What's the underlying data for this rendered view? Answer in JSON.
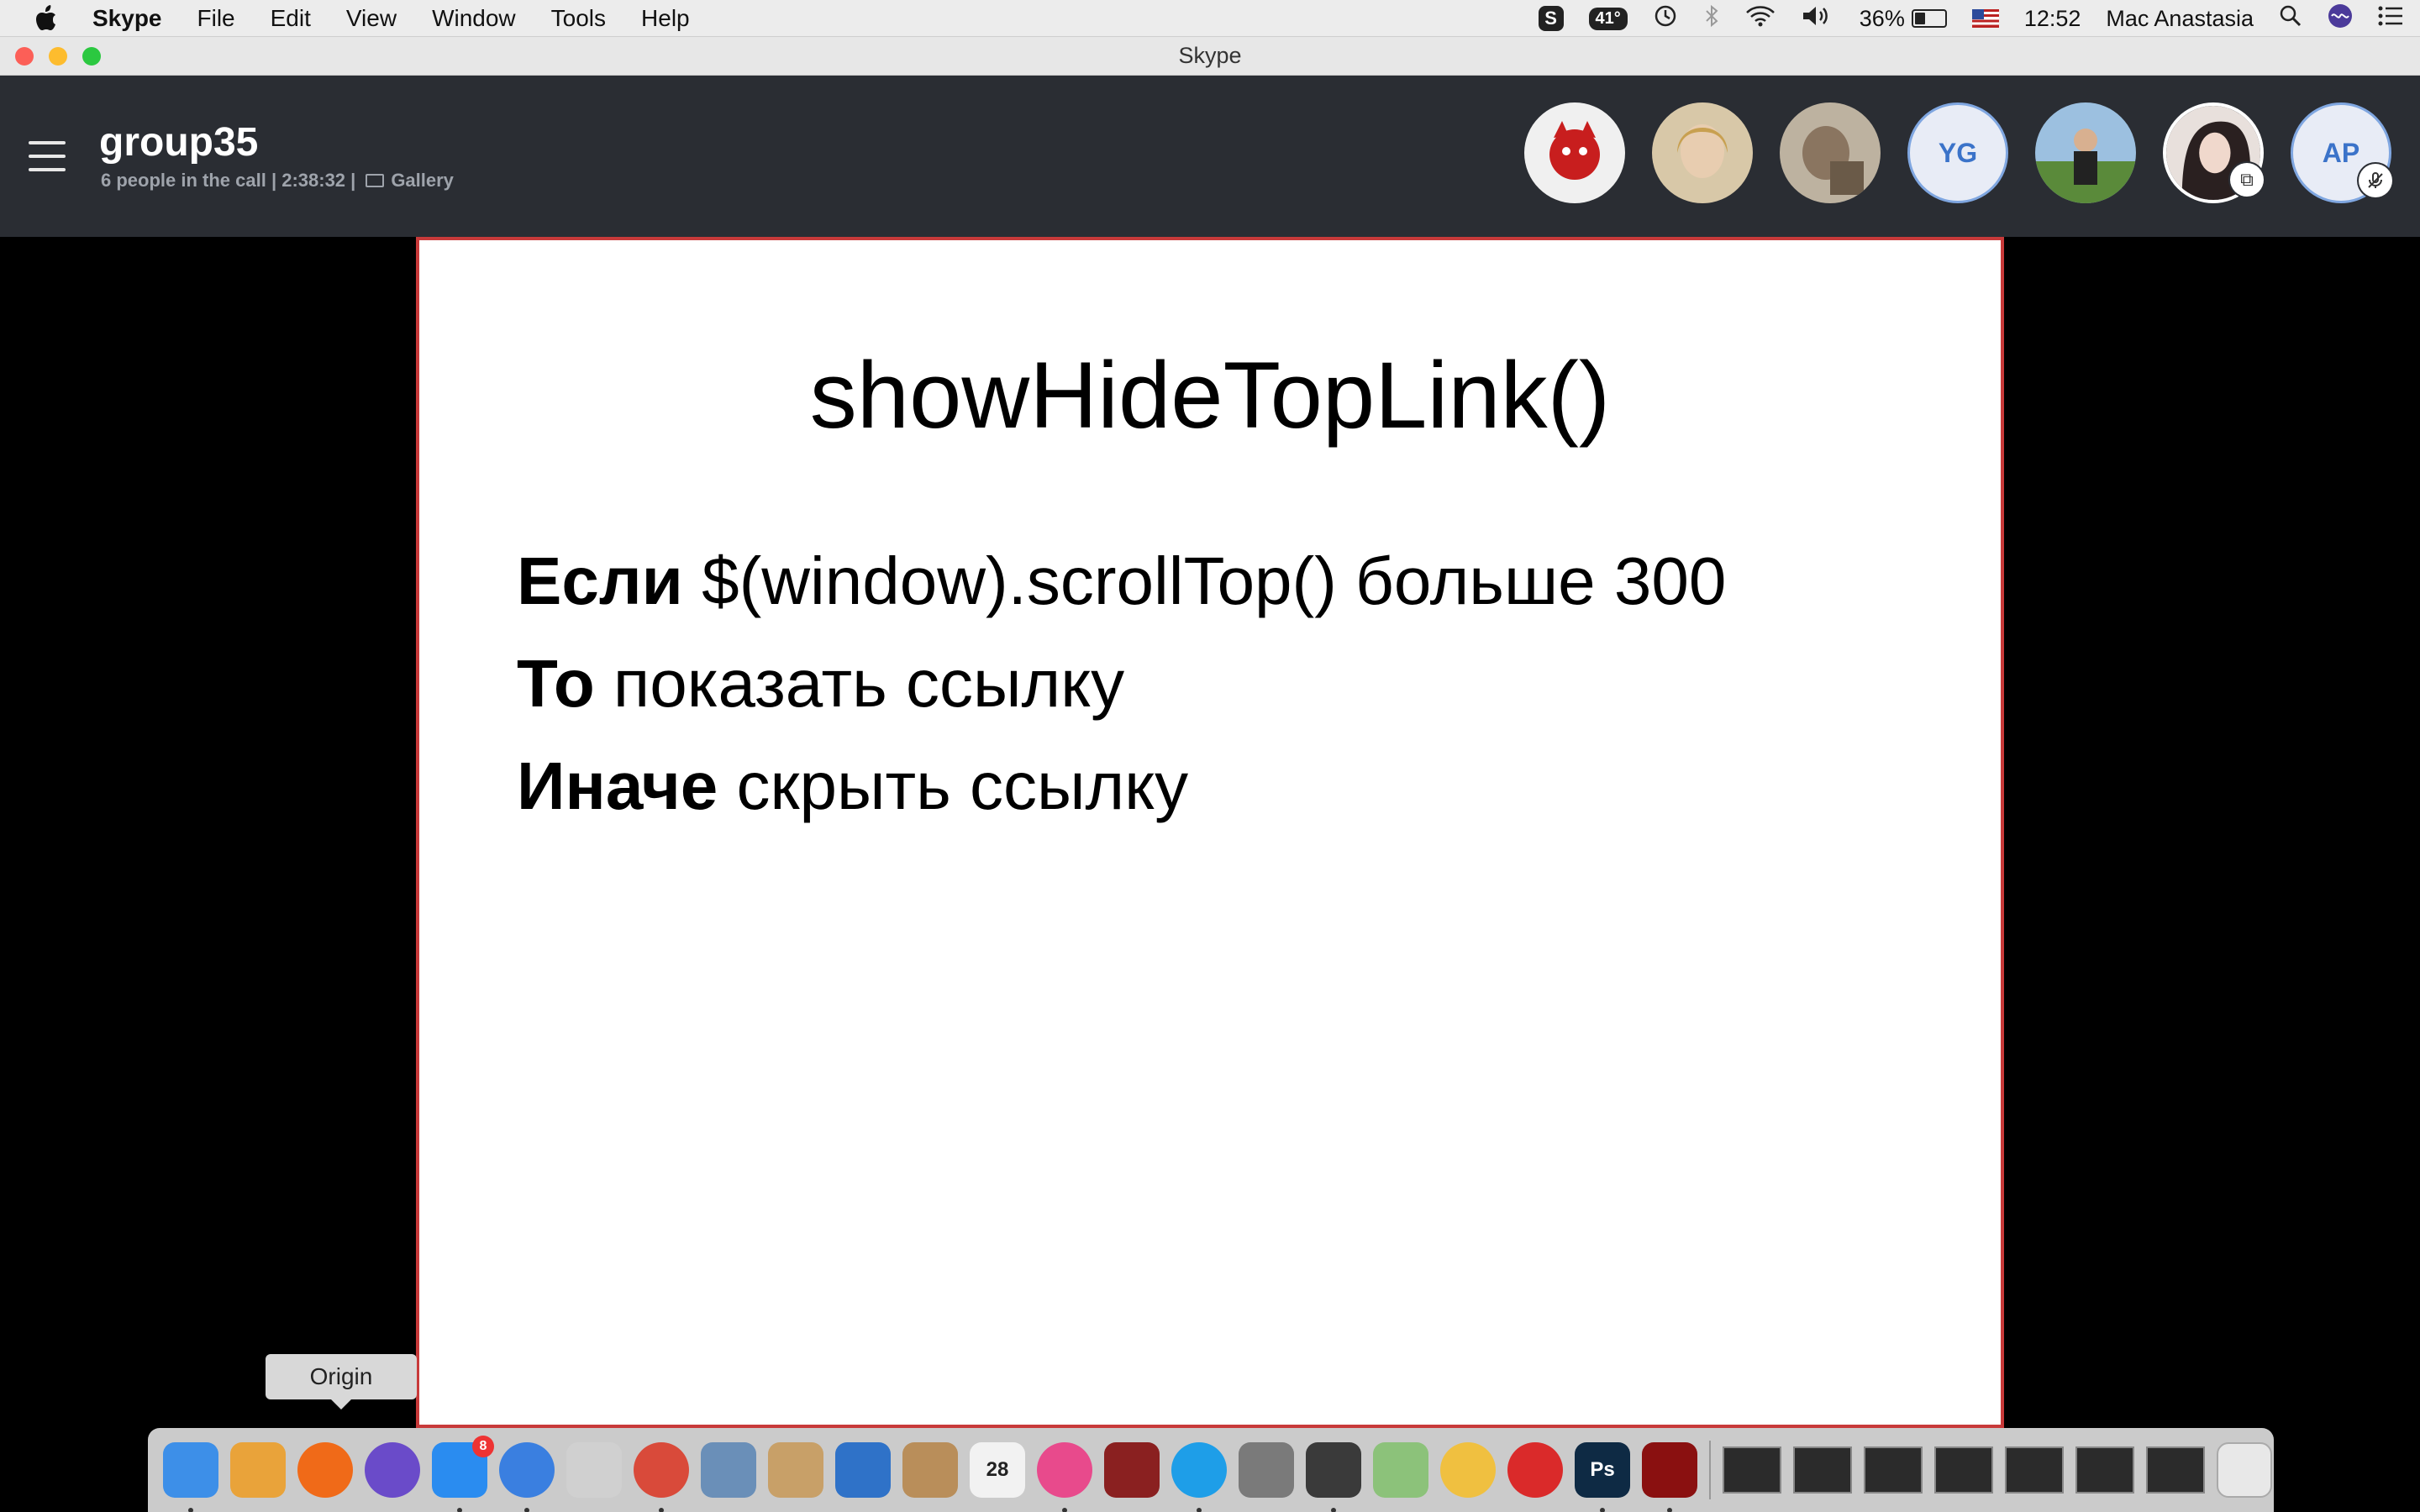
{
  "menubar": {
    "app_name": "Skype",
    "items": [
      "File",
      "Edit",
      "View",
      "Window",
      "Tools",
      "Help"
    ],
    "status": {
      "temperature": "41°",
      "battery": "36%",
      "battery_level": 0.36,
      "clock": "12:52",
      "user": "Mac Anastasia"
    }
  },
  "window": {
    "title": "Skype"
  },
  "call": {
    "group_name": "group35",
    "subtitle": "6 people in the call | 2:38:32  |",
    "view_mode": "Gallery",
    "participants": [
      {
        "type": "photo",
        "icon": "red-devil-avatar",
        "color": "#c81e1e"
      },
      {
        "type": "photo",
        "icon": "woman-blonde-avatar",
        "color": "#b8a27a"
      },
      {
        "type": "photo",
        "icon": "person-thinking-avatar",
        "color": "#8c7a66"
      },
      {
        "type": "initials",
        "initials": "YG"
      },
      {
        "type": "photo",
        "icon": "man-outdoors-avatar",
        "color": "#4e7a3a"
      },
      {
        "type": "photo",
        "icon": "woman-dark-hair-avatar",
        "color": "#3a3030",
        "badge": "screen-share-icon",
        "selected": true
      },
      {
        "type": "initials",
        "initials": "AP",
        "badge": "mic-muted-icon"
      }
    ]
  },
  "slide": {
    "title": "showHideTopLink()",
    "lines": [
      {
        "bold": "Если",
        "rest": " $(window).scrollTop() больше 300"
      },
      {
        "bold": "То",
        "rest": " показать ссылку"
      },
      {
        "bold": "Иначе",
        "rest": " скрыть ссылку"
      }
    ]
  },
  "tooltip": {
    "text": "Origin"
  },
  "dock": {
    "apps": [
      {
        "name": "finder",
        "color": "#3d8fe8",
        "running": true
      },
      {
        "name": "text-editor",
        "color": "#e9a33a"
      },
      {
        "name": "origin",
        "color": "#f06a18"
      },
      {
        "name": "siri",
        "color": "#6a4bc9"
      },
      {
        "name": "app-store",
        "color": "#2a8cf0",
        "badge": "8",
        "running": true
      },
      {
        "name": "safari",
        "color": "#3a7fe0",
        "running": true
      },
      {
        "name": "launchpad",
        "color": "#d0d0d0"
      },
      {
        "name": "chrome",
        "color": "#d94a3a",
        "running": true
      },
      {
        "name": "preview",
        "color": "#6a8fb8"
      },
      {
        "name": "files",
        "color": "#c8a068"
      },
      {
        "name": "mail-bird",
        "color": "#2f72c8"
      },
      {
        "name": "contacts",
        "color": "#b98e5a"
      },
      {
        "name": "calendar",
        "color": "#f2f2f2",
        "label": "28"
      },
      {
        "name": "itunes",
        "color": "#e84a8c",
        "running": true
      },
      {
        "name": "photo-booth",
        "color": "#8a2020"
      },
      {
        "name": "skype",
        "color": "#1e9ee8",
        "running": true
      },
      {
        "name": "system-preferences",
        "color": "#7a7a7a"
      },
      {
        "name": "sublime-text",
        "color": "#3a3a3a",
        "running": true
      },
      {
        "name": "maps",
        "color": "#8cc27a"
      },
      {
        "name": "photos",
        "color": "#f0c040"
      },
      {
        "name": "creative-cloud",
        "color": "#da2a2a"
      },
      {
        "name": "photoshop",
        "color": "#0e2a44",
        "label": "Ps",
        "running": true
      },
      {
        "name": "acrobat",
        "color": "#8a1010",
        "running": true
      }
    ],
    "windows_count": 7,
    "trash": "trash-icon"
  }
}
